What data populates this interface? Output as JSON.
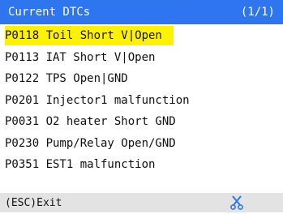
{
  "header": {
    "title": "Current DTCs",
    "page_indicator": "(1/1)"
  },
  "dtc_list": [
    {
      "text": "P0118 Toil Short V|Open",
      "selected": true
    },
    {
      "text": "P0113 IAT Short V|Open",
      "selected": false
    },
    {
      "text": "P0122 TPS Open|GND",
      "selected": false
    },
    {
      "text": "P0201 Injector1 malfunction",
      "selected": false
    },
    {
      "text": "P0031 O2 heater Short GND",
      "selected": false
    },
    {
      "text": "P0230 Pump/Relay Open/GND",
      "selected": false
    },
    {
      "text": "P0351 EST1 malfunction",
      "selected": false
    }
  ],
  "footer": {
    "exit_label": "(ESC)Exit",
    "tool_icon": "scissors-icon"
  },
  "colors": {
    "header_bg": "#2e76f0",
    "selection": "#fff200",
    "footer_bg": "#e3e3e3",
    "icon": "#2e76f0"
  }
}
